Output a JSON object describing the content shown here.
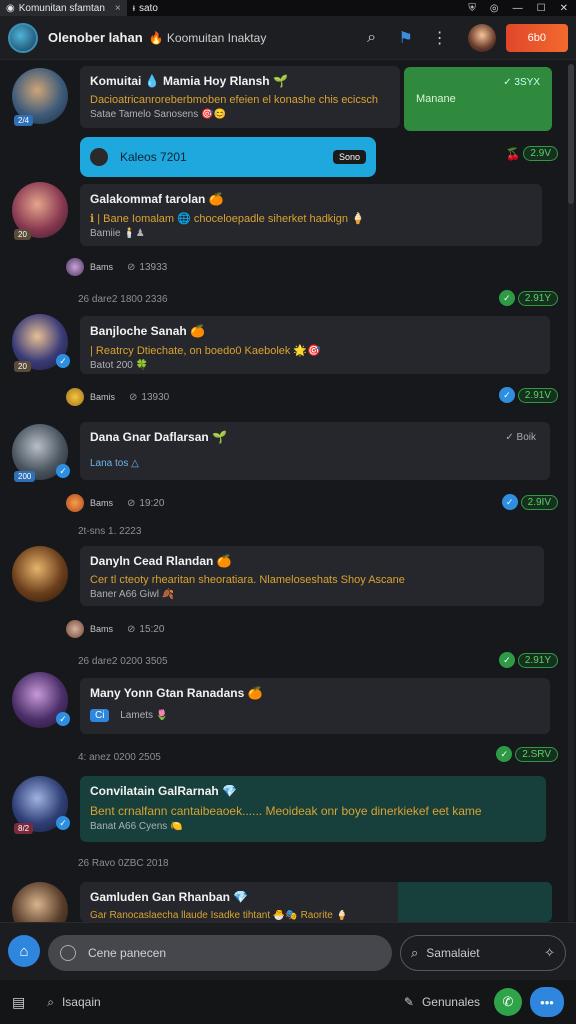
{
  "tabs": [
    {
      "label": "Komunitan sfamtan",
      "close": "×"
    },
    {
      "label": "sato"
    }
  ],
  "window_controls": {
    "shield": "⛨",
    "globe": "◎",
    "minimize": "—",
    "maximize": "☐",
    "close": "✕"
  },
  "header": {
    "title": "Olenober lahan",
    "subtitle": "Koomuitan Inaktay",
    "action_label": "6b0"
  },
  "messages": [
    {
      "name": "Komuitai 💧 Mamia Hoy Rlansh 🌱",
      "text": "Dacioatricanroreberbmoben efeien el konashe chis ecicsch",
      "meta": "Satae Tamelo Sanosens 🎯😊",
      "badge": "2/4",
      "card_text": "Manane",
      "card_check": "✓ 3SYX"
    },
    {
      "pill_label": "Kaleos 7201",
      "pill_tag": "Sono",
      "stat": "2.9V"
    },
    {
      "name": "Galakommaf tarolan 🍊",
      "text": "ℹ | Bane Iomalam 🌐 choceloepadle siherket hadkign 🍦",
      "meta": "Bamiie 🕯️♟",
      "badge": "20",
      "sub_name": "Bams",
      "sub_time": "13933",
      "date": "26 dare2  1800 2336",
      "stat": "2.91Y"
    },
    {
      "name": "Banjloche Sanah 🍊",
      "text": "| Reatrcy Dtiechate, on boedo0 Kaebolek 🌟🎯",
      "meta": "Batot 200 🍀",
      "badge": "20",
      "sub_name": "Bamis",
      "sub_time": "13930",
      "stat": "2.91V"
    },
    {
      "name": "Dana Gnar Daflarsan 🌱",
      "text": "",
      "meta": "Lana tos △",
      "badge": "200",
      "check": "✓ Boik",
      "sub_name": "Bams",
      "sub_time": "19:20",
      "date": "2t-sns    1. 2223",
      "stat": "2.9IV"
    },
    {
      "name": "Danyln Cead Rlandan 🍊",
      "text": "Cer tl cteoty rhearitan sheoratiara. Nlameloseshats Shoy Ascane",
      "meta": "Baner A66 Giwl 🍂",
      "sub_name": "Bams",
      "sub_time": "15:20",
      "date": "26 dare2  0200 3505",
      "stat": "2.91Y"
    },
    {
      "name": "Many Yonn Gtan Ranadans 🍊",
      "chip": "Ci",
      "meta": "Lamets 🌷",
      "date": "4: anez    0200 2505",
      "stat": "2.SRV"
    },
    {
      "name": "Convilatain GalRarnah 💎",
      "text": "Bent crnalfann cantaibeaoek...... Meoideak onr boye dinerkiekef eet kame",
      "meta": "Banat A66 Cyens 🍋",
      "date": "26 Ravo  0ZBC 2018"
    },
    {
      "name": "Gamluden Gan Rhanban 💎",
      "text": "Gar Ranocaslaecha llaude Isadke tihtant 🐣🎭 Raorite 🍦"
    }
  ],
  "composer": {
    "placeholder": "Cene panecen",
    "search_placeholder": "Samalaiet"
  },
  "bottom": {
    "search_label": "Isaqain",
    "right_label": "Genunales"
  },
  "colors": {
    "accent": "#2e86de",
    "green": "#2f9a45",
    "orange": "#e0472a",
    "bubble": "#26272c",
    "teal": "#173f3c"
  }
}
